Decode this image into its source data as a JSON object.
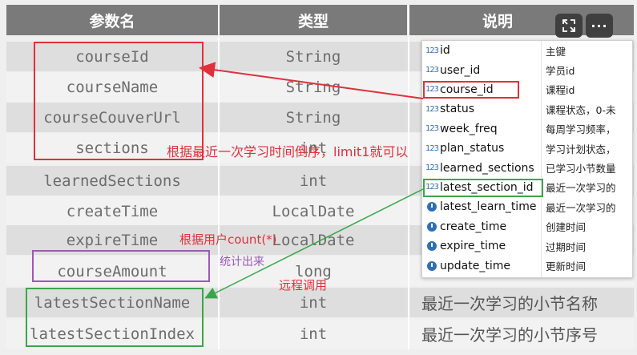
{
  "table": {
    "headers": [
      "参数名",
      "类型",
      "说明"
    ],
    "rows": [
      {
        "name": "courseId",
        "type": "String",
        "desc": ""
      },
      {
        "name": "courseName",
        "type": "String",
        "desc": ""
      },
      {
        "name": "courseCouverUrl",
        "type": "String",
        "desc": ""
      },
      {
        "name": "sections",
        "type": "int",
        "desc": ""
      },
      {
        "name": "learnedSections",
        "type": "int",
        "desc": ""
      },
      {
        "name": "createTime",
        "type": "LocalDate",
        "desc": ""
      },
      {
        "name": "expireTime",
        "type": "LocalDate",
        "desc": ""
      },
      {
        "name": "courseAmount",
        "type": "long",
        "desc": ""
      },
      {
        "name": "latestSectionName",
        "type": "int",
        "desc": "最近一次学习的小节名称"
      },
      {
        "name": "latestSectionIndex",
        "type": "int",
        "desc": "最近一次学习的小节序号"
      }
    ]
  },
  "popup": {
    "rows": [
      {
        "icon": "123",
        "name": "id",
        "desc": "主键"
      },
      {
        "icon": "123",
        "name": "user_id",
        "desc": "学员id"
      },
      {
        "icon": "123",
        "name": "course_id",
        "desc": "课程id"
      },
      {
        "icon": "123",
        "name": "status",
        "desc": "课程状态，0-未"
      },
      {
        "icon": "123",
        "name": "week_freq",
        "desc": "每周学习频率，"
      },
      {
        "icon": "123",
        "name": "plan_status",
        "desc": "学习计划状态，"
      },
      {
        "icon": "123",
        "name": "learned_sections",
        "desc": "已学习小节数量"
      },
      {
        "icon": "123",
        "name": "latest_section_id",
        "desc": "最近一次学习的"
      },
      {
        "icon": "clock",
        "name": "latest_learn_time",
        "desc": "最近一次学习的"
      },
      {
        "icon": "clock",
        "name": "create_time",
        "desc": "创建时间"
      },
      {
        "icon": "clock",
        "name": "expire_time",
        "desc": "过期时间"
      },
      {
        "icon": "clock",
        "name": "update_time",
        "desc": "更新时间"
      }
    ]
  },
  "toolbar": {
    "expand_icon": "expand-icon",
    "more_label": "···"
  },
  "annotations": {
    "sort_note": "根据最近一次学习时间倒序，limit1就可以",
    "count_note": "根据用户count(*)",
    "tally_note": "统计出来",
    "remote_note": "远程调用"
  },
  "colors": {
    "red": "#e0303a",
    "green": "#3aa64a",
    "purple": "#9b59b6",
    "header_bg": "#7a7a7a"
  }
}
